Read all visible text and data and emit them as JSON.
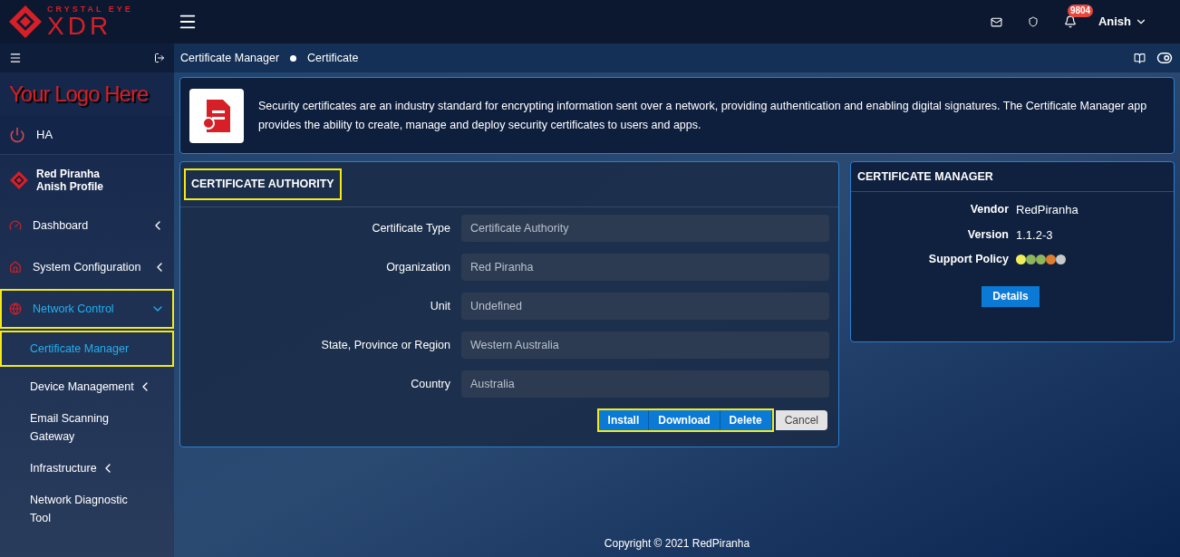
{
  "brand": {
    "top": "CRYSTAL EYE",
    "main": "XDR"
  },
  "topbar": {
    "notification_badge": "9804",
    "user": "Anish"
  },
  "sidebar": {
    "logo_text": "Your Logo Here",
    "ha_label": "HA",
    "profile": {
      "name": "Red Piranha",
      "subtitle": "Anish Profile"
    },
    "items": [
      {
        "label": "Dashboard",
        "kind": "section",
        "expanded": false,
        "selected": false,
        "highlighted": false
      },
      {
        "label": "System Configuration",
        "kind": "section",
        "expanded": false,
        "selected": false,
        "highlighted": false
      },
      {
        "label": "Network Control",
        "kind": "section",
        "expanded": true,
        "selected": true,
        "highlighted": true
      },
      {
        "label": "Certificate Manager",
        "kind": "sub",
        "selected": true,
        "highlighted": true,
        "has_children": false
      },
      {
        "label": "Device Management",
        "kind": "sub",
        "selected": false,
        "highlighted": false,
        "has_children": true
      },
      {
        "label": "Email Scanning Gateway",
        "kind": "sub",
        "selected": false,
        "highlighted": false,
        "has_children": false
      },
      {
        "label": "Infrastructure",
        "kind": "sub",
        "selected": false,
        "highlighted": false,
        "has_children": true
      },
      {
        "label": "Network Diagnostic Tool",
        "kind": "sub",
        "selected": false,
        "highlighted": false,
        "has_children": false
      }
    ]
  },
  "breadcrumb": [
    "Certificate Manager",
    "Certificate"
  ],
  "intro": "Security certificates are an industry standard for encrypting information sent over a network, providing authentication and enabling digital signatures. The Certificate Manager app provides the ability to create, manage and deploy security certificates to users and apps.",
  "form": {
    "title": "CERTIFICATE AUTHORITY",
    "title_highlighted": true,
    "fields": [
      {
        "label": "Certificate Type",
        "value": "Certificate Authority"
      },
      {
        "label": "Organization",
        "value": "Red Piranha"
      },
      {
        "label": "Unit",
        "value": "Undefined"
      },
      {
        "label": "State, Province or Region",
        "value": "Western Australia"
      },
      {
        "label": "Country",
        "value": "Australia"
      }
    ],
    "buttons": [
      {
        "label": "Install",
        "kind": "primary"
      },
      {
        "label": "Download",
        "kind": "primary"
      },
      {
        "label": "Delete",
        "kind": "primary"
      },
      {
        "label": "Cancel",
        "kind": "secondary"
      }
    ],
    "primary_highlighted": true
  },
  "app_info": {
    "title": "CERTIFICATE MANAGER",
    "rows": [
      {
        "label": "Vendor",
        "value": "RedPiranha"
      },
      {
        "label": "Version",
        "value": "1.1.2-3"
      }
    ],
    "support_label": "Support Policy",
    "support_dots": [
      {
        "color": "#f2ee5a"
      },
      {
        "color": "#8fb65a"
      },
      {
        "color": "#8fb65a"
      },
      {
        "color": "#e07d2e"
      },
      {
        "color": "#c8c8c8"
      }
    ],
    "button": "Details"
  },
  "footer": "Copyright © 2021 RedPiranha"
}
